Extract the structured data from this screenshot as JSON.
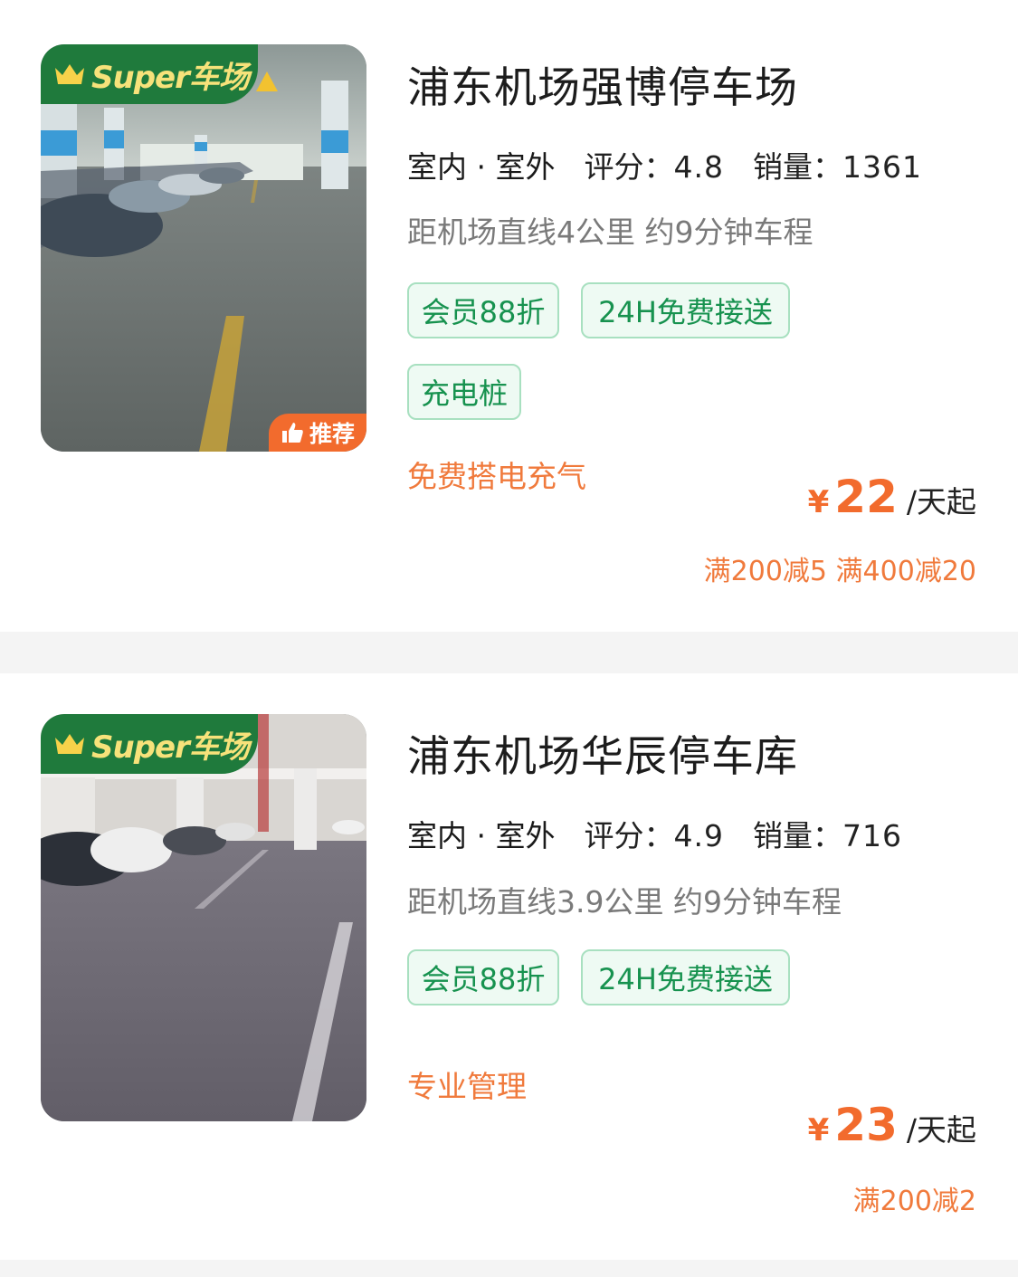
{
  "colors": {
    "accent_green": "#1f7a3c",
    "tag_green": "#17924f",
    "orange": "#f26b2d",
    "super_text": "#f7e27a"
  },
  "listings": [
    {
      "badge": "Super车场",
      "recommend_label": "推荐",
      "name": "浦东机场强博停车场",
      "type_label": "室内 · 室外",
      "rating_label": "评分：",
      "rating": "4.8",
      "sales_label": "销量：",
      "sales": "1361",
      "distance": "距机场直线4公里 约9分钟车程",
      "tags": [
        "会员88折",
        "24H免费接送",
        "充电桩"
      ],
      "feature": "免费搭电充气",
      "currency": "¥",
      "price": "22",
      "price_unit": "/天起",
      "discount": "满200减5 满400减20",
      "photo_icon": "parking-garage-photo"
    },
    {
      "badge": "Super车场",
      "name": "浦东机场华辰停车库",
      "type_label": "室内 · 室外",
      "rating_label": "评分：",
      "rating": "4.9",
      "sales_label": "销量：",
      "sales": "716",
      "distance": "距机场直线3.9公里 约9分钟车程",
      "tags": [
        "会员88折",
        "24H免费接送"
      ],
      "feature": "专业管理",
      "currency": "¥",
      "price": "23",
      "price_unit": "/天起",
      "discount": "满200减2",
      "photo_icon": "parking-garage-photo"
    }
  ]
}
